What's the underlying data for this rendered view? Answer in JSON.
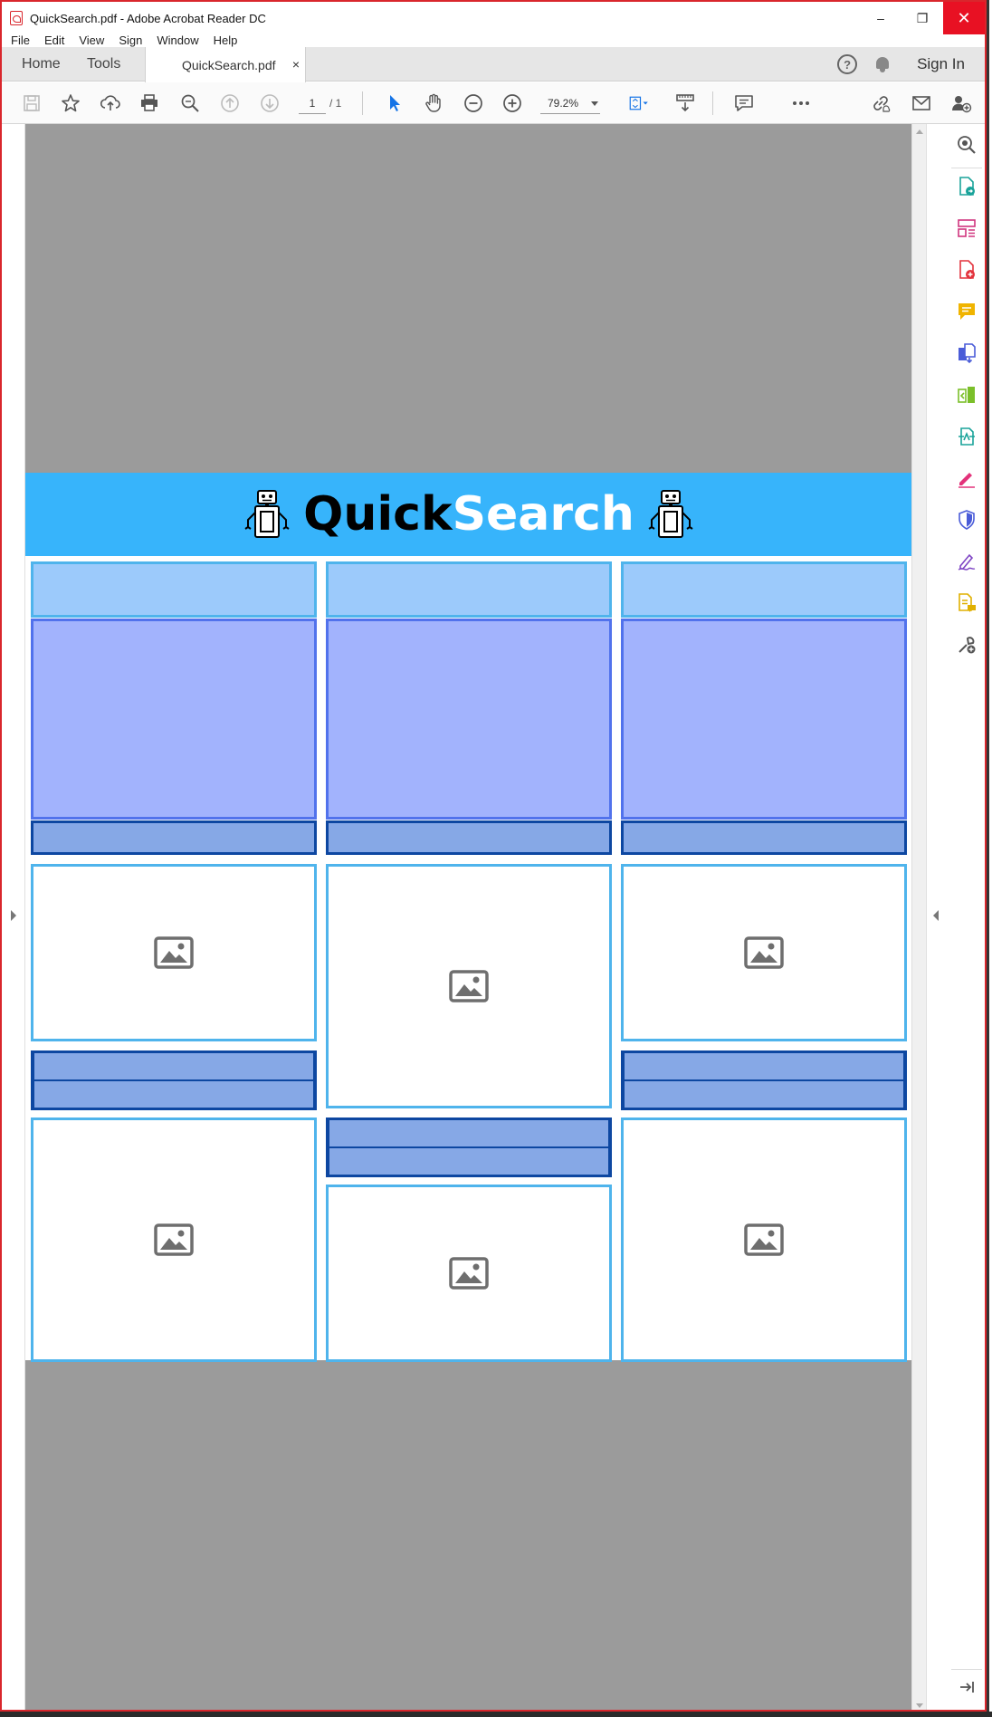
{
  "window": {
    "title": "QuickSearch.pdf - Adobe Acrobat Reader DC",
    "controls": {
      "minimize": "–",
      "restore": "❐",
      "close": "✕"
    }
  },
  "menu": [
    "File",
    "Edit",
    "View",
    "Sign",
    "Window",
    "Help"
  ],
  "tabs": {
    "home": "Home",
    "tools": "Tools",
    "document": "QuickSearch.pdf",
    "close_glyph": "×",
    "help_glyph": "?",
    "sign_in": "Sign In"
  },
  "toolbar": {
    "page_current": "1",
    "page_total": "/ 1",
    "zoom": "79.2%",
    "icons": [
      "save-icon",
      "bookmark-star-icon",
      "upload-cloud-icon",
      "print-icon",
      "find-icon",
      "prev-page-icon",
      "next-page-icon",
      "select-pointer-icon",
      "hand-icon",
      "zoom-out-icon",
      "zoom-in-icon",
      "fit-page-icon",
      "scroll-mode-icon",
      "comment-icon",
      "more-icon",
      "share-link-icon",
      "email-icon",
      "add-user-icon"
    ]
  },
  "pdf": {
    "banner": {
      "title_part1": "Quick",
      "title_part2": "Search",
      "color": "#37b4fb"
    },
    "colors": {
      "header_fill": "#9ccafb",
      "body_fill": "#a2b3fd",
      "footer_fill": "#86a8e6",
      "image_border": "#4fb4ec",
      "dark_border": "#0d47a1"
    }
  },
  "tools_pane": {
    "icons": [
      "search-zoom-icon",
      "export-pdf-icon",
      "organize-pages-icon",
      "create-pdf-icon",
      "comment-tool-icon",
      "combine-files-icon",
      "compress-icon",
      "enhance-scan-icon",
      "fill-sign-icon",
      "protect-icon",
      "signature-icon",
      "send-for-comments-icon",
      "more-tools-icon",
      "collapse-pane-icon"
    ]
  }
}
